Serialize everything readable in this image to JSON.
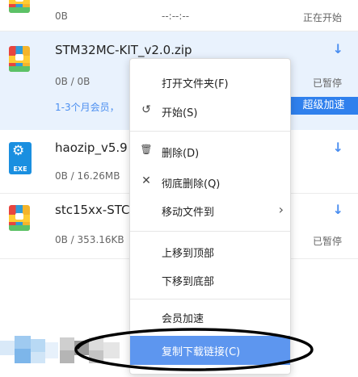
{
  "downloads": [
    {
      "id": "partial",
      "size": "0B",
      "time": "--:--:--",
      "status": "正在开始"
    },
    {
      "id": "stm",
      "name": "STM32MC-KIT_v2.0.zip",
      "size": "0B / 0B",
      "status": "已暂停",
      "member_text": "1-3个月会员，",
      "boost_label": "超级加速"
    },
    {
      "id": "haozip",
      "name": "haozip_v5.9",
      "size": "0B / 16.26MB",
      "icon_label": "EXE"
    },
    {
      "id": "stc",
      "name": "stc15xx-STC",
      "size": "0B / 353.16KB",
      "status": "已暂停"
    }
  ],
  "context_menu": {
    "items": [
      {
        "label": "打开文件夹(F)"
      },
      {
        "label": "开始(S)",
        "icon": "↺"
      },
      {
        "label": "删除(D)",
        "icon": "🗑"
      },
      {
        "label": "彻底删除(Q)",
        "icon": "✕"
      },
      {
        "label": "移动文件到",
        "submenu": "›"
      },
      {
        "label": "上移到顶部"
      },
      {
        "label": "下移到底部"
      },
      {
        "label": "会员加速"
      },
      {
        "label": "复制下载链接(C)"
      }
    ]
  },
  "colors": {
    "accent": "#2f80ed",
    "selected_row": "#e9f2fd",
    "menu_highlight": "#5d96ef",
    "annotation": "#000000"
  }
}
